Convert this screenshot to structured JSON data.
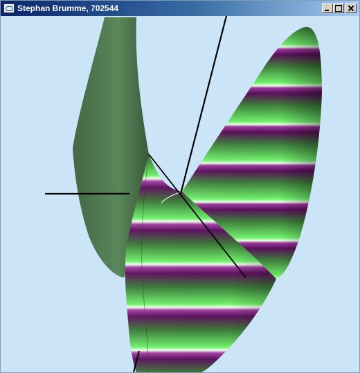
{
  "window": {
    "title": "Stephan Brumme, 702544"
  },
  "caption_buttons": {
    "minimize_icon": "minimize-icon",
    "maximize_icon": "maximize-icon",
    "close_icon": "close-icon"
  },
  "scene": {
    "background_color": "#cce4f8",
    "surface_colors": [
      "#6fe86a",
      "#2e6b2e",
      "#6a1a6a"
    ],
    "axis_color": "#000000"
  }
}
